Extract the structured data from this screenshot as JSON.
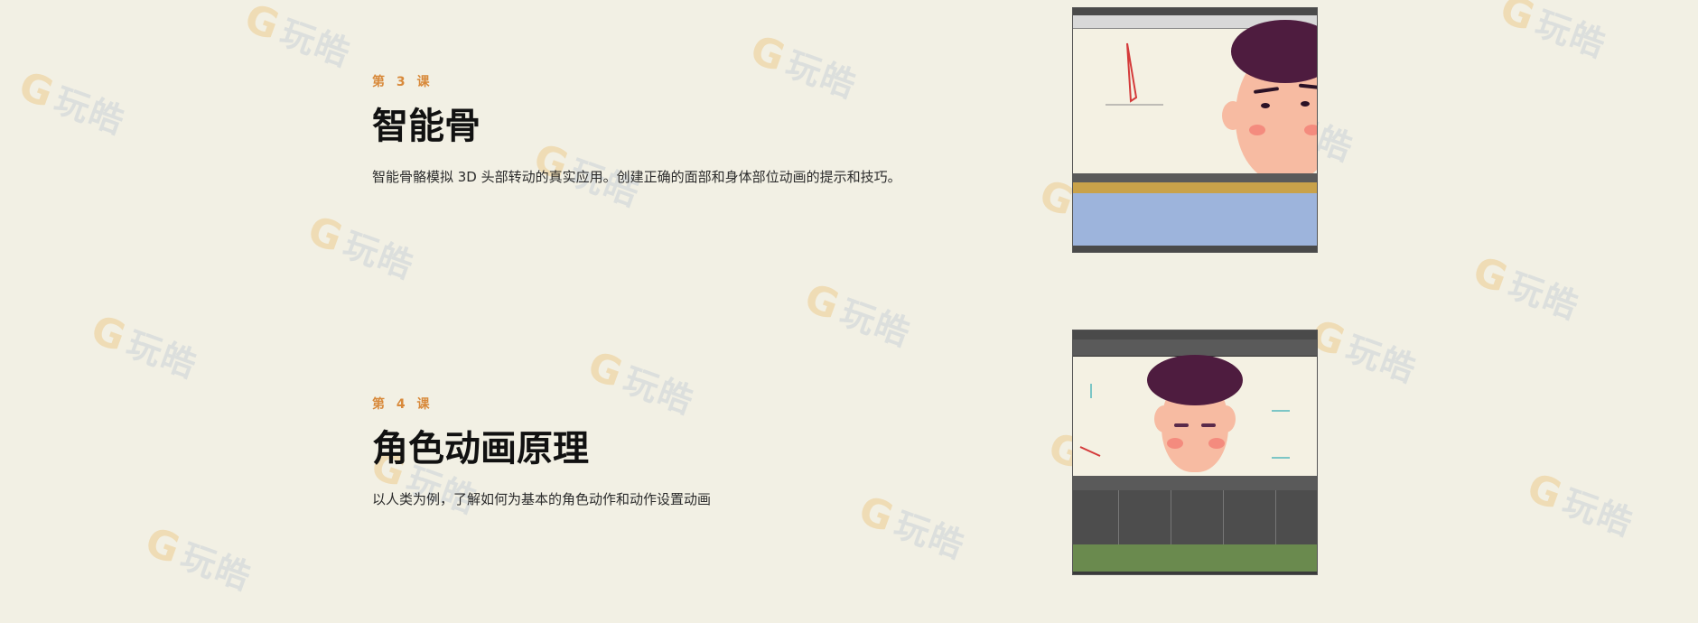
{
  "lessons": [
    {
      "label": "第 3 课",
      "title": "智能骨",
      "description": "智能骨骼模拟 3D 头部转动的真实应用。创建正确的面部和身体部位动画的提示和技巧。",
      "thumbnail_name": "smart-bone-preview"
    },
    {
      "label": "第 4 课",
      "title": "角色动画原理",
      "description": "以人类为例，了解如何为基本的角色动作和动作设置动画",
      "thumbnail_name": "character-animation-preview"
    }
  ],
  "watermark": {
    "text": "玩皓",
    "glyph": "G"
  },
  "colors": {
    "background": "#f2f0e4",
    "label": "#d8893a",
    "title": "#111111",
    "hair": "#4e1c3f",
    "skin": "#f7bba2",
    "timeline_blue": "#9db4dc",
    "timeline_green": "#6a8a4e"
  }
}
